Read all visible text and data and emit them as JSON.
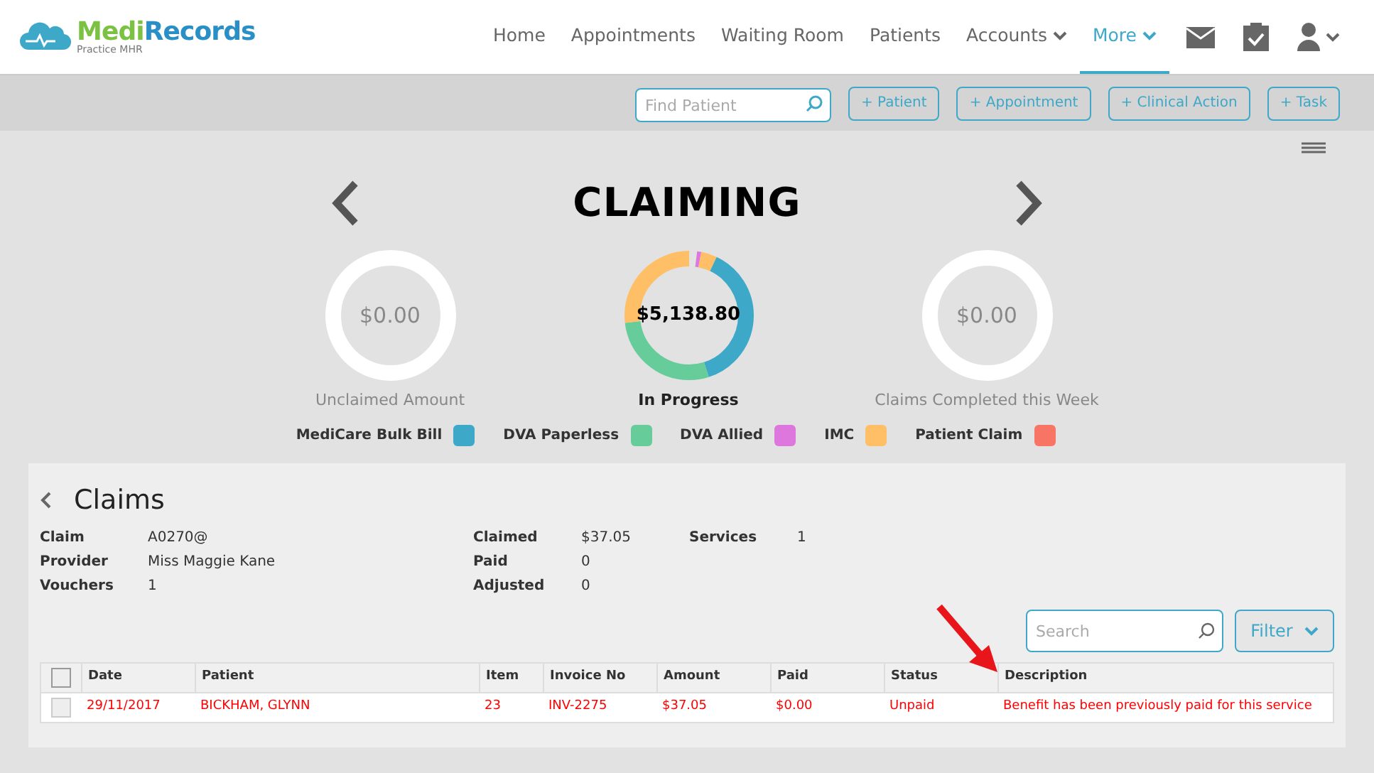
{
  "brand": {
    "name_a": "Medi",
    "name_b": "Records",
    "subtitle": "Practice MHR"
  },
  "nav": [
    {
      "label": "Home",
      "selected": false,
      "dropdown": false
    },
    {
      "label": "Appointments",
      "selected": false,
      "dropdown": false
    },
    {
      "label": "Waiting Room",
      "selected": false,
      "dropdown": false
    },
    {
      "label": "Patients",
      "selected": false,
      "dropdown": false
    },
    {
      "label": "Accounts",
      "selected": false,
      "dropdown": true
    },
    {
      "label": "More",
      "selected": true,
      "dropdown": true
    }
  ],
  "toolbar": {
    "search": {
      "placeholder": "Find Patient"
    },
    "buttons": [
      "+ Patient",
      "+ Appointment",
      "+ Clinical Action",
      "+ Task"
    ]
  },
  "heading": "CLAIMING",
  "summaries": [
    {
      "amount": "$0.00",
      "label": "Unclaimed Amount",
      "kind": "empty"
    },
    {
      "amount": "$5,138.80",
      "label": "In Progress",
      "kind": "donut"
    },
    {
      "amount": "$0.00",
      "label": "Claims Completed this Week",
      "kind": "empty"
    }
  ],
  "legend": [
    {
      "label": "MediCare Bulk Bill",
      "color": "#3ea8c8"
    },
    {
      "label": "DVA Paperless",
      "color": "#66cc99"
    },
    {
      "label": "DVA Allied",
      "color": "#dd77dd"
    },
    {
      "label": "IMC",
      "color": "#ffbf66"
    },
    {
      "label": "Patient Claim",
      "color": "#f87566"
    }
  ],
  "claims": {
    "title": "Claims",
    "details": [
      [
        {
          "label": "Claim",
          "value": "A0270@"
        },
        {
          "label": "Provider",
          "value": "Miss Maggie Kane"
        },
        {
          "label": "Vouchers",
          "value": "1"
        }
      ],
      [
        {
          "label": "Claimed",
          "value": "$37.05"
        },
        {
          "label": "Paid",
          "value": "0"
        },
        {
          "label": "Adjusted",
          "value": "0"
        }
      ],
      [
        {
          "label": "Services",
          "value": "1"
        }
      ]
    ],
    "search": {
      "placeholder": "Search"
    },
    "filter": "Filter",
    "select_all": {
      "checked": false
    },
    "columns": [
      "Date",
      "Patient",
      "Item",
      "Invoice No",
      "Amount",
      "Paid",
      "Status",
      "Description"
    ],
    "rows": [
      {
        "checked": false,
        "error": true,
        "cells": [
          "29/11/2017",
          "BICKHAM, GLYNN",
          "23",
          "INV-2275",
          "$37.05",
          "$0.00",
          "Unpaid",
          "Benefit has been previously paid for this service"
        ]
      }
    ]
  }
}
